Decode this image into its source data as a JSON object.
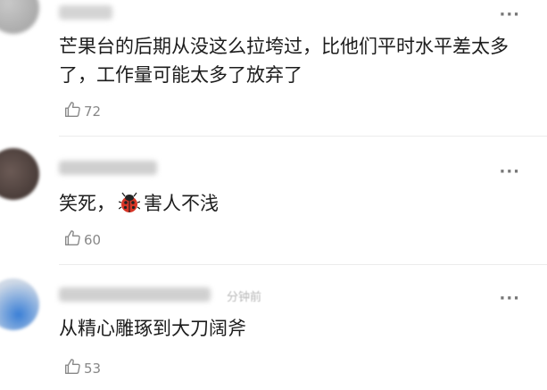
{
  "comments": [
    {
      "text": "芒果台的后期从没这么拉垮过，比他们平时水平差太多了，工作量可能太多了放弃了",
      "likes": "72",
      "more_label": "···"
    },
    {
      "text_before": "笑死，",
      "emoji": "ladybug-emoji",
      "text_after": "害人不浅",
      "likes": "60",
      "more_label": "···"
    },
    {
      "text": "从精心雕琢到大刀阔斧",
      "timestamp": "分钟前",
      "likes": "53",
      "more_label": "···"
    }
  ],
  "icons": {
    "like": "thumbs-up-outline-icon",
    "more": "ellipsis-icon"
  },
  "colors": {
    "text": "#1c1c1c",
    "meta": "#888888",
    "divider": "#ececec"
  }
}
